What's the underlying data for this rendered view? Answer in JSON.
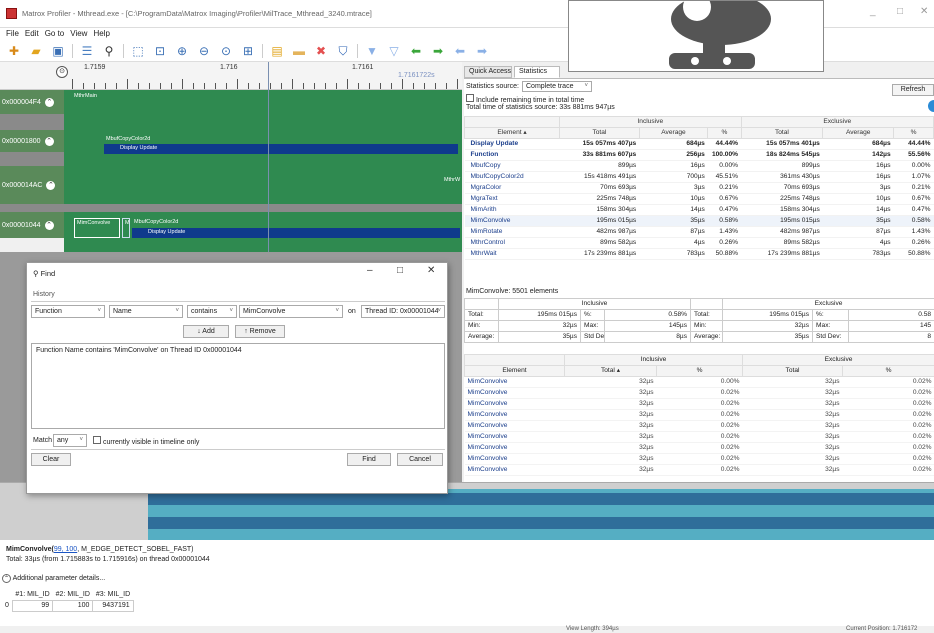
{
  "window": {
    "title": "Matrox Profiler - Mthread.exe - [C:\\ProgramData\\Matrox Imaging\\Profiler\\MilTrace_Mthread_3240.mtrace]",
    "controls": [
      "_",
      "□",
      "✕"
    ]
  },
  "menu": [
    "File",
    "Edit",
    "Go to",
    "View",
    "Help"
  ],
  "timeline": {
    "ruler_labels": [
      "1.7159",
      "1.716",
      "1.7161",
      "1.7161722s"
    ],
    "lanes": [
      {
        "id": "0x000004F4",
        "blocks": [
          "MthrMain"
        ]
      },
      {
        "id": "0x00001800",
        "blocks": [
          "MbufCopyColor2d",
          "Display Update"
        ]
      },
      {
        "id": "0x000014AC",
        "blocks": [
          "MthrW"
        ]
      },
      {
        "id": "0x00001044",
        "blocks": [
          "MimConvolve",
          "Mb",
          "MbufCopyColor2d",
          "Display Update"
        ]
      }
    ]
  },
  "tabs": [
    "Quick Access",
    "Statistics"
  ],
  "stats": {
    "source_label": "Statistics source:",
    "source_value": "Complete trace",
    "include_label": "Include remaining time in total time",
    "total_time": "Total time of statistics source: 33s 881ms 947µs",
    "refresh": "Refresh",
    "group_inclusive": "Inclusive",
    "group_exclusive": "Exclusive",
    "columns": [
      "Element",
      "Total",
      "Average",
      "%",
      "Total",
      "Average",
      "%"
    ],
    "rows": [
      {
        "name": "Display Update",
        "it": "15s 057ms 407µs",
        "ia": "684µs",
        "ip": "44.44%",
        "et": "15s 057ms 401µs",
        "ea": "684µs",
        "ep": "44.44%",
        "bold": true
      },
      {
        "name": "Function",
        "it": "33s 881ms 607µs",
        "ia": "256µs",
        "ip": "100.00%",
        "et": "18s 824ms 545µs",
        "ea": "142µs",
        "ep": "55.56%",
        "bold": true
      },
      {
        "name": "MbufCopy",
        "it": "899µs",
        "ia": "16µs",
        "ip": "0.00%",
        "et": "899µs",
        "ea": "16µs",
        "ep": "0.00%"
      },
      {
        "name": "MbufCopyColor2d",
        "it": "15s 418ms 491µs",
        "ia": "700µs",
        "ip": "45.51%",
        "et": "361ms 430µs",
        "ea": "16µs",
        "ep": "1.07%"
      },
      {
        "name": "MgraColor",
        "it": "70ms 693µs",
        "ia": "3µs",
        "ip": "0.21%",
        "et": "70ms 693µs",
        "ea": "3µs",
        "ep": "0.21%"
      },
      {
        "name": "MgraText",
        "it": "225ms 748µs",
        "ia": "10µs",
        "ip": "0.67%",
        "et": "225ms 748µs",
        "ea": "10µs",
        "ep": "0.67%"
      },
      {
        "name": "MimArith",
        "it": "158ms 304µs",
        "ia": "14µs",
        "ip": "0.47%",
        "et": "158ms 304µs",
        "ea": "14µs",
        "ep": "0.47%"
      },
      {
        "name": "MimConvolve",
        "it": "195ms 015µs",
        "ia": "35µs",
        "ip": "0.58%",
        "et": "195ms 015µs",
        "ea": "35µs",
        "ep": "0.58%",
        "sel": true
      },
      {
        "name": "MimRotate",
        "it": "482ms 987µs",
        "ia": "87µs",
        "ip": "1.43%",
        "et": "482ms 987µs",
        "ea": "87µs",
        "ep": "1.43%"
      },
      {
        "name": "MthrControl",
        "it": "89ms 582µs",
        "ia": "4µs",
        "ip": "0.26%",
        "et": "89ms 582µs",
        "ea": "4µs",
        "ep": "0.26%"
      },
      {
        "name": "MthrWait",
        "it": "17s 239ms 881µs",
        "ia": "783µs",
        "ip": "50.88%",
        "et": "17s 239ms 881µs",
        "ea": "783µs",
        "ep": "50.88%"
      }
    ],
    "elements_title": "MimConvolve: 5501 elements",
    "summary": {
      "total_label": "Total:",
      "total_incl": "195ms 015µs",
      "pct_label": "%:",
      "pct_incl": "0.58%",
      "total_excl": "195ms 015µs",
      "pct_excl": "0.58",
      "min_label": "Min:",
      "min_incl": "32µs",
      "max_label": "Max:",
      "max_incl": "145µs",
      "min_excl": "32µs",
      "max_excl": "145",
      "avg_label": "Average:",
      "avg_incl": "35µs",
      "std_label": "Std Dev:",
      "std_incl": "8µs",
      "avg_excl": "35µs",
      "std_excl": "8"
    },
    "elem_columns": [
      "Element",
      "Total",
      "%",
      "Total",
      "%"
    ],
    "elem_rows": [
      {
        "name": "MimConvolve",
        "it": "32µs",
        "ip": "0.00%",
        "et": "32µs",
        "ep": "0.02%"
      },
      {
        "name": "MimConvolve",
        "it": "32µs",
        "ip": "0.02%",
        "et": "32µs",
        "ep": "0.02%"
      },
      {
        "name": "MimConvolve",
        "it": "32µs",
        "ip": "0.02%",
        "et": "32µs",
        "ep": "0.02%"
      },
      {
        "name": "MimConvolve",
        "it": "32µs",
        "ip": "0.02%",
        "et": "32µs",
        "ep": "0.02%"
      },
      {
        "name": "MimConvolve",
        "it": "32µs",
        "ip": "0.02%",
        "et": "32µs",
        "ep": "0.02%"
      },
      {
        "name": "MimConvolve",
        "it": "32µs",
        "ip": "0.02%",
        "et": "32µs",
        "ep": "0.02%"
      },
      {
        "name": "MimConvolve",
        "it": "32µs",
        "ip": "0.02%",
        "et": "32µs",
        "ep": "0.02%"
      },
      {
        "name": "MimConvolve",
        "it": "32µs",
        "ip": "0.02%",
        "et": "32µs",
        "ep": "0.02%"
      },
      {
        "name": "MimConvolve",
        "it": "32µs",
        "ip": "0.02%",
        "et": "32µs",
        "ep": "0.02%"
      }
    ]
  },
  "find": {
    "title": "Find",
    "history": "History",
    "category": "Function",
    "field": "Name",
    "op": "contains",
    "value": "MimConvolve",
    "on": "on",
    "thread": "Thread ID: 0x00001044",
    "add": "↓ Add",
    "remove": "↑ Remove",
    "criteria": "Function Name contains 'MimConvolve' on Thread ID 0x00001044",
    "match_label": "Match",
    "match_value": "any",
    "visible_label": "currently visible in timeline only",
    "clear": "Clear",
    "find_btn": "Find",
    "cancel": "Cancel"
  },
  "detail": {
    "fn": "MimConvolve(",
    "args": "99, 100",
    "rest": ", M_EDGE_DETECT_SOBEL_FAST)",
    "timing": "Total: 33µs (from 1.715883s to 1.715916s) on thread 0x00001044",
    "additional": "Additional parameter details...",
    "param_headers": [
      "#1: MIL_ID",
      "#2: MIL_ID",
      "#3: MIL_ID"
    ],
    "param_row_index": "0",
    "param_values": [
      "99",
      "100",
      "9437191"
    ]
  },
  "status": {
    "view_length": "View Length: 394µs",
    "cursor": "Current Position: 1.716172"
  }
}
